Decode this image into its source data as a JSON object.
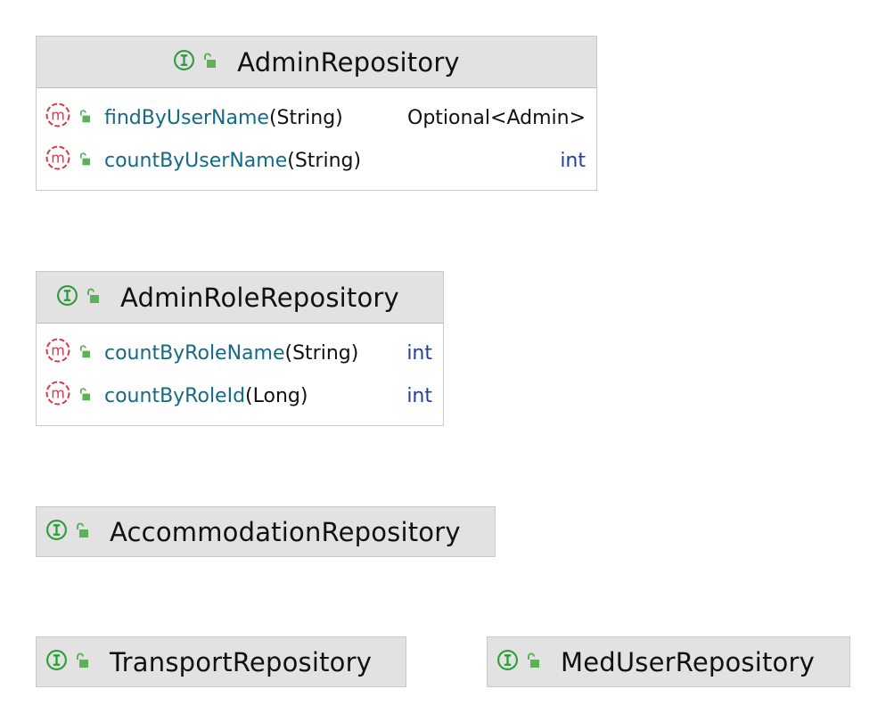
{
  "colors": {
    "header_bg": "#e2e2e2",
    "border": "#c9c9c9",
    "interface_icon": "#2e9a3c",
    "method_icon": "#d53a4b",
    "lock_icon": "#5eb05b",
    "method_name": "#146a87",
    "keyword": "#1c3fae",
    "text": "#111111"
  },
  "nodes": [
    {
      "title": "AdminRepository",
      "icon": "interface-icon",
      "members": [
        {
          "name": "findByUserName",
          "params": "(String)",
          "return_type": "Optional<Admin>"
        },
        {
          "name": "countByUserName",
          "params": "(String)",
          "return_type": "int"
        }
      ]
    },
    {
      "title": "AdminRoleRepository",
      "icon": "interface-icon",
      "members": [
        {
          "name": "countByRoleName",
          "params": "(String)",
          "return_type": "int"
        },
        {
          "name": "countByRoleId",
          "params": "(Long)",
          "return_type": "int"
        }
      ]
    },
    {
      "title": "AccommodationRepository",
      "icon": "interface-icon",
      "members": []
    },
    {
      "title": "TransportRepository",
      "icon": "interface-icon",
      "members": []
    },
    {
      "title": "MedUserRepository",
      "icon": "interface-icon",
      "members": []
    }
  ]
}
